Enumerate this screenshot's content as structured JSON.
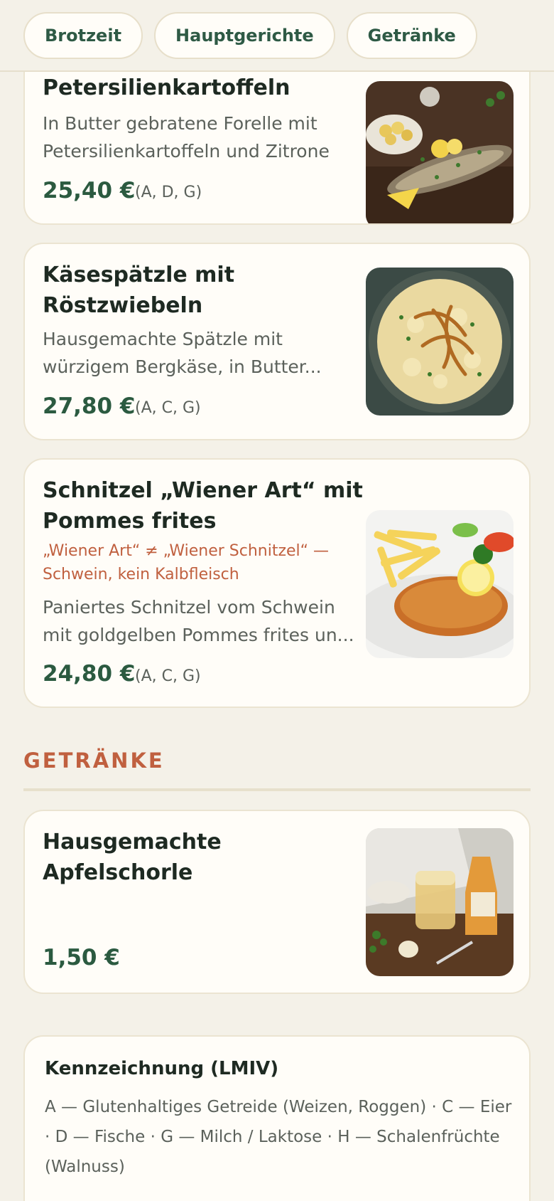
{
  "tabs": [
    {
      "label": "Brotzeit"
    },
    {
      "label": "Hauptgerichte"
    },
    {
      "label": "Getränke"
    }
  ],
  "dishes": [
    {
      "title": "Petersilienkartoffeln",
      "description": "In Butter gebratene Forelle mit Petersilienkartoffeln und Zitrone",
      "price": "25,40 €",
      "allergens": "(A, D, G)",
      "image": "trout-with-potatoes-photo"
    },
    {
      "title": "Käsespätzle mit Röstzwiebeln",
      "description": "Hausgemachte Spätzle mit würzigem Bergkäse, in Butter...",
      "price": "27,80 €",
      "allergens": "(A, C, G)",
      "image": "kaesespaetzle-photo"
    },
    {
      "title": "Schnitzel „Wiener Art“ mit Pommes frites",
      "note": "„Wiener Art“ ≠ „Wiener Schnitzel“ — Schwein, kein Kalbfleisch",
      "description": "Paniertes Schnitzel vom Schwein mit goldgelben Pommes frites un...",
      "price": "24,80 €",
      "allergens": "(A, C, G)",
      "image": "schnitzel-fries-photo"
    }
  ],
  "drinks_section": {
    "heading": "GETRÄNKE",
    "items": [
      {
        "title": "Hausgemachte Apfelschorle",
        "price": "1,50 €",
        "image": "apple-spritzer-photo"
      }
    ]
  },
  "legend": {
    "title": "Kennzeichnung (LMIV)",
    "text": "A — Glutenhaltiges Getreide (Weizen, Roggen) · C — Eier · D — Fische · G — Milch / Laktose · H — Schalenfrüchte (Walnuss)"
  },
  "colors": {
    "background": "#f4f1e8",
    "card": "#fffdf8",
    "price": "#2b5a40",
    "accent": "#c0603f"
  }
}
